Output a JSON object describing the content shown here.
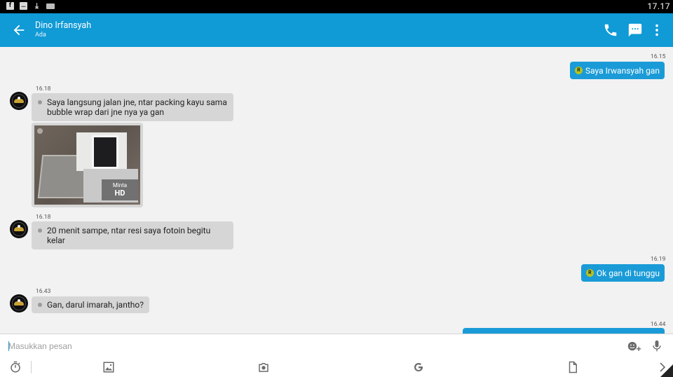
{
  "status_bar": {
    "time": "17.17",
    "icons": [
      "facebook-icon",
      "chat-notification-icon",
      "download-icon",
      "keyboard-icon"
    ]
  },
  "header": {
    "contact_name": "Dino Irfansyah",
    "contact_status": "Ada",
    "actions": [
      "back-icon",
      "phone-icon",
      "sms-icon",
      "more-vert-icon"
    ],
    "accent_color": "#109ad6"
  },
  "messages": [
    {
      "direction": "out",
      "time": "16.15",
      "badge": "R",
      "text": "Saya Irwansyah gan"
    },
    {
      "direction": "in",
      "time": "16.18",
      "text": "Saya langsung jalan jne, ntar packing kayu sama bubble wrap dari jne nya ya gan"
    },
    {
      "direction": "in",
      "type": "photo",
      "hd_request": "Minta",
      "hd_label": "HD"
    },
    {
      "direction": "in",
      "time": "16.18",
      "text": "20 menit sampe, ntar resi saya fotoin begitu kelar"
    },
    {
      "direction": "out",
      "time": "16.19",
      "badge": "R",
      "text": "Ok gan di tunggu"
    },
    {
      "direction": "in",
      "time": "16.43",
      "text": "Gan, darul imarah, jantho?"
    },
    {
      "direction": "out",
      "time": "16.44",
      "text": ""
    }
  ],
  "composer": {
    "placeholder": "Masukkan pesan",
    "value": ""
  },
  "toolbar": [
    "timer-icon",
    "gallery-icon",
    "camera-icon",
    "google-icon",
    "file-icon",
    "chevron-right-icon"
  ],
  "colors": {
    "incoming_bubble": "#d6d6d6",
    "outgoing_bubble": "#1a9bd7",
    "background": "#f2f2f2"
  }
}
